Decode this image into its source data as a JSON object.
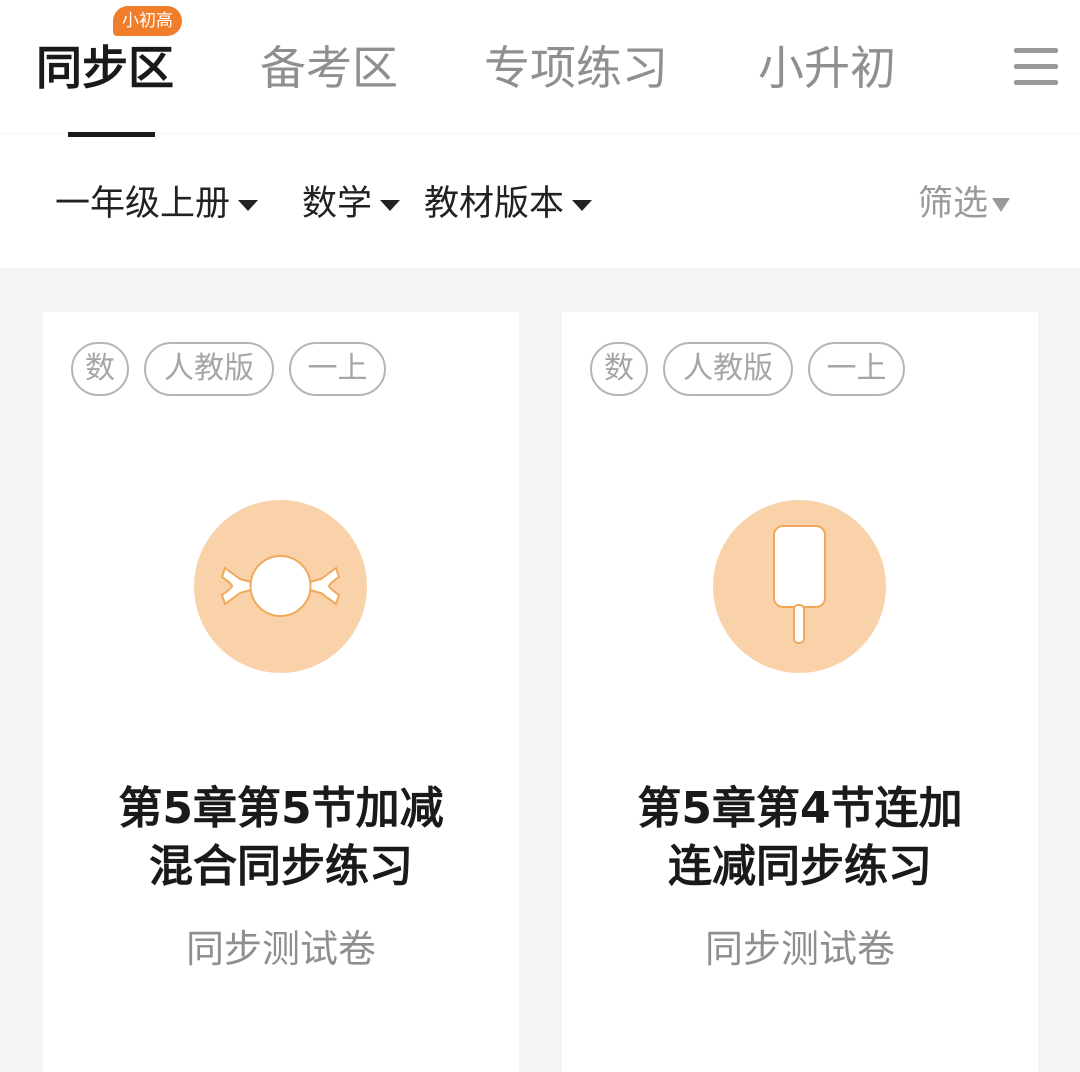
{
  "nav": {
    "tabs": [
      {
        "label": "同步区",
        "active": true
      },
      {
        "label": "备考区",
        "active": false
      },
      {
        "label": "专项练习",
        "active": false
      },
      {
        "label": "小升初",
        "active": false
      }
    ],
    "badge": "小初高",
    "menu_icon": "hamburger-menu-icon"
  },
  "filters": {
    "grade": "一年级上册",
    "subject": "数学",
    "version": "教材版本",
    "filter_label": "筛选"
  },
  "cards": [
    {
      "tags": [
        "数",
        "人教版",
        "一上"
      ],
      "icon": "candy-icon",
      "title_line1": "第5章第5节加减",
      "title_line2": "混合同步练习",
      "subtitle": "同步测试卷"
    },
    {
      "tags": [
        "数",
        "人教版",
        "一上"
      ],
      "icon": "popsicle-icon",
      "title_line1": "第5章第4节连加",
      "title_line2": "连减同步练习",
      "subtitle": "同步测试卷"
    }
  ],
  "colors": {
    "accent": "#f07d2a",
    "icon_circle": "#f9d2a9",
    "active_text": "#1a1a1a",
    "inactive_text": "#8f8f8f",
    "background": "#f5f5f5"
  }
}
